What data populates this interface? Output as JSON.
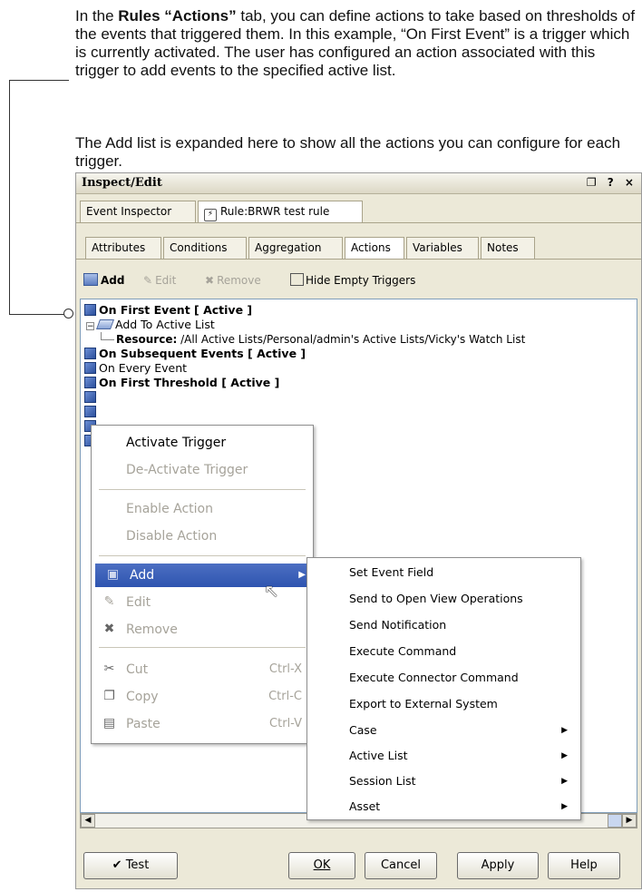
{
  "caption": {
    "p1_pre": "In the ",
    "p1_bold": "Rules “Actions”",
    "p1_post": " tab, you can define actions to take based on thresholds of the events that triggered them. In this example, “On First Event” is a trigger which is currently activated. The user has configured an action associated with this trigger to add events to the specified active list.",
    "p2": "The Add list is expanded here to show all the actions you can configure for each trigger."
  },
  "window": {
    "title": "Inspect/Edit",
    "controls": "❐ ? ×"
  },
  "top_tabs": [
    "Event Inspector",
    "Rule:BRWR test rule"
  ],
  "sub_tabs": [
    "Attributes",
    "Conditions",
    "Aggregation",
    "Actions",
    "Variables",
    "Notes"
  ],
  "toolbar": {
    "add": "Add",
    "edit": "Edit",
    "remove": "Remove",
    "hide_empty": "Hide Empty Triggers"
  },
  "tree": {
    "on_first_event": "On First Event [ Active ]",
    "add_to_active_list": "Add To Active List",
    "resource_label": "Resource:",
    "resource_value": " /All Active Lists/Personal/admin's Active Lists/Vicky's Watch List",
    "on_subsequent": "On Subsequent Events [ Active ]",
    "on_every": "On Every Event",
    "on_first_threshold": "On First Threshold [ Active ]"
  },
  "context_menu": {
    "activate": "Activate Trigger",
    "deactivate": "De-Activate Trigger",
    "enable": "Enable Action",
    "disable": "Disable Action",
    "add": "Add",
    "edit": "Edit",
    "remove": "Remove",
    "cut": "Cut",
    "cut_sc": "Ctrl-X",
    "copy": "Copy",
    "copy_sc": "Ctrl-C",
    "paste": "Paste",
    "paste_sc": "Ctrl-V"
  },
  "submenu": [
    "Set Event Field",
    "Send to Open View Operations",
    "Send Notification",
    "Execute Command",
    "Execute Connector Command",
    "Export to External System",
    "Case",
    "Active List",
    "Session List",
    "Asset"
  ],
  "buttons": {
    "test": "Test",
    "ok": "OK",
    "cancel": "Cancel",
    "apply": "Apply",
    "help": "Help"
  },
  "colors": {
    "highlight": "#2e55b0",
    "window_bg": "#ece9d8",
    "border": "#7f9db9"
  }
}
